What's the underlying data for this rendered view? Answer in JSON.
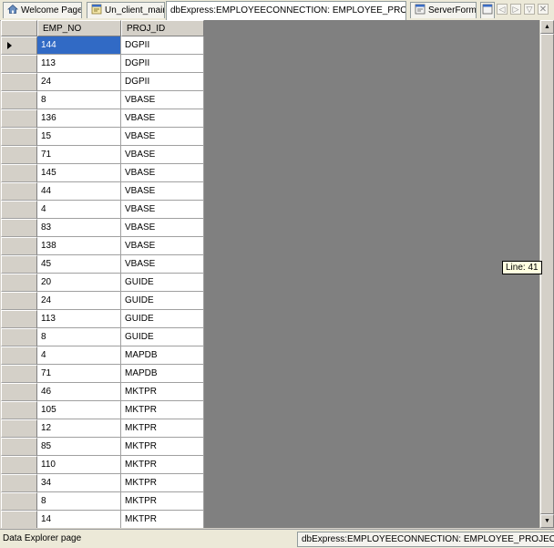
{
  "tabs": [
    {
      "label": "Welcome Page",
      "icon": "home-icon"
    },
    {
      "label": "Un_client_main",
      "icon": "form-icon"
    },
    {
      "label": "dbExpress:EMPLOYEECONNECTION: EMPLOYEE_PROJECT",
      "icon": ""
    },
    {
      "label": "ServerForm",
      "icon": "form-icon"
    }
  ],
  "nav": {
    "prev": "◁",
    "next": "▷",
    "list": "▽"
  },
  "grid": {
    "columns": [
      "EMP_NO",
      "PROJ_ID"
    ],
    "rows": [
      [
        "144",
        "DGPII"
      ],
      [
        "113",
        "DGPII"
      ],
      [
        "24",
        "DGPII"
      ],
      [
        "8",
        "VBASE"
      ],
      [
        "136",
        "VBASE"
      ],
      [
        "15",
        "VBASE"
      ],
      [
        "71",
        "VBASE"
      ],
      [
        "145",
        "VBASE"
      ],
      [
        "44",
        "VBASE"
      ],
      [
        "4",
        "VBASE"
      ],
      [
        "83",
        "VBASE"
      ],
      [
        "138",
        "VBASE"
      ],
      [
        "45",
        "VBASE"
      ],
      [
        "20",
        "GUIDE"
      ],
      [
        "24",
        "GUIDE"
      ],
      [
        "113",
        "GUIDE"
      ],
      [
        "8",
        "GUIDE"
      ],
      [
        "4",
        "MAPDB"
      ],
      [
        "71",
        "MAPDB"
      ],
      [
        "46",
        "MKTPR"
      ],
      [
        "105",
        "MKTPR"
      ],
      [
        "12",
        "MKTPR"
      ],
      [
        "85",
        "MKTPR"
      ],
      [
        "110",
        "MKTPR"
      ],
      [
        "34",
        "MKTPR"
      ],
      [
        "8",
        "MKTPR"
      ],
      [
        "14",
        "MKTPR"
      ]
    ]
  },
  "tooltip": "Line: 41",
  "status": {
    "left": "Data Explorer page",
    "right": "dbExpress:EMPLOYEECONNECTION: EMPLOYEE_PROJECT"
  },
  "colors": {
    "selection": "#316ac5",
    "grid_background": "#808080"
  }
}
